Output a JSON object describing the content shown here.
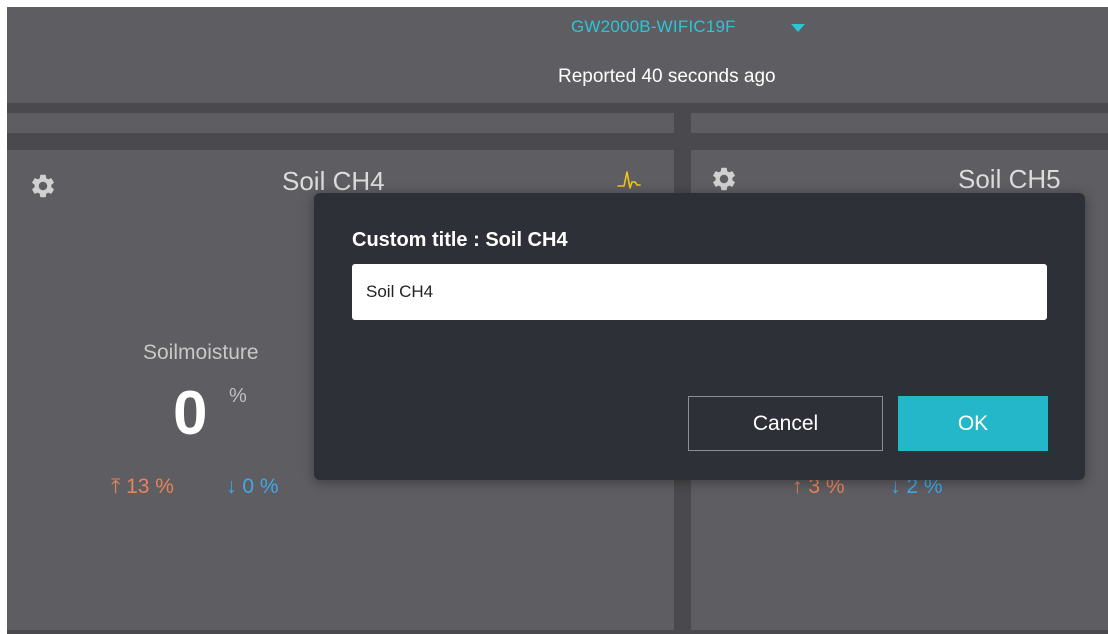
{
  "header": {
    "device_name": "GW2000B-WIFIC19F",
    "reported": "Reported 40 seconds ago"
  },
  "cards": [
    {
      "title": "Soil CH4",
      "metric_label": "Soilmoisture",
      "value": "0",
      "unit": "%",
      "high": "⤒ 13 %",
      "low": "↓ 0 %"
    },
    {
      "title": "Soil CH5",
      "high": "↑ 3 %",
      "low": "↓ 2 %"
    }
  ],
  "modal": {
    "title": "Custom title : Soil CH4",
    "input_value": "Soil CH4",
    "cancel_label": "Cancel",
    "ok_label": "OK"
  },
  "icons": {
    "settings": "gear-icon",
    "chart": "chart-icon",
    "dropdown": "caret-down-icon"
  },
  "colors": {
    "accent": "#2ec4d6",
    "ok_button": "#23b7c9",
    "high": "#e9845a",
    "low": "#3fa8e8",
    "chart_icon": "#f0c419"
  }
}
